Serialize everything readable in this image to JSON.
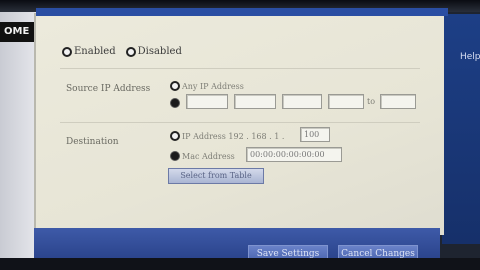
{
  "left_tab": "OME",
  "status_options": [
    "Enabled",
    "Disabled"
  ],
  "source_ip": {
    "label": "Source IP Address",
    "any_option": "Any IP Address",
    "range_separator": "to",
    "octets": [
      "",
      "",
      "",
      "",
      ""
    ]
  },
  "destination": {
    "label": "Destination",
    "ip_option": "IP Address 192 . 168 . 1 .",
    "ip_last_octet": "100",
    "mac_option": "Mac Address",
    "mac_value": "00:00:00:00:00:00",
    "clone_button": "Select from Table"
  },
  "right_label": "Help",
  "footer": {
    "save_button": "Save Settings",
    "cancel_button": "Cancel Changes"
  }
}
